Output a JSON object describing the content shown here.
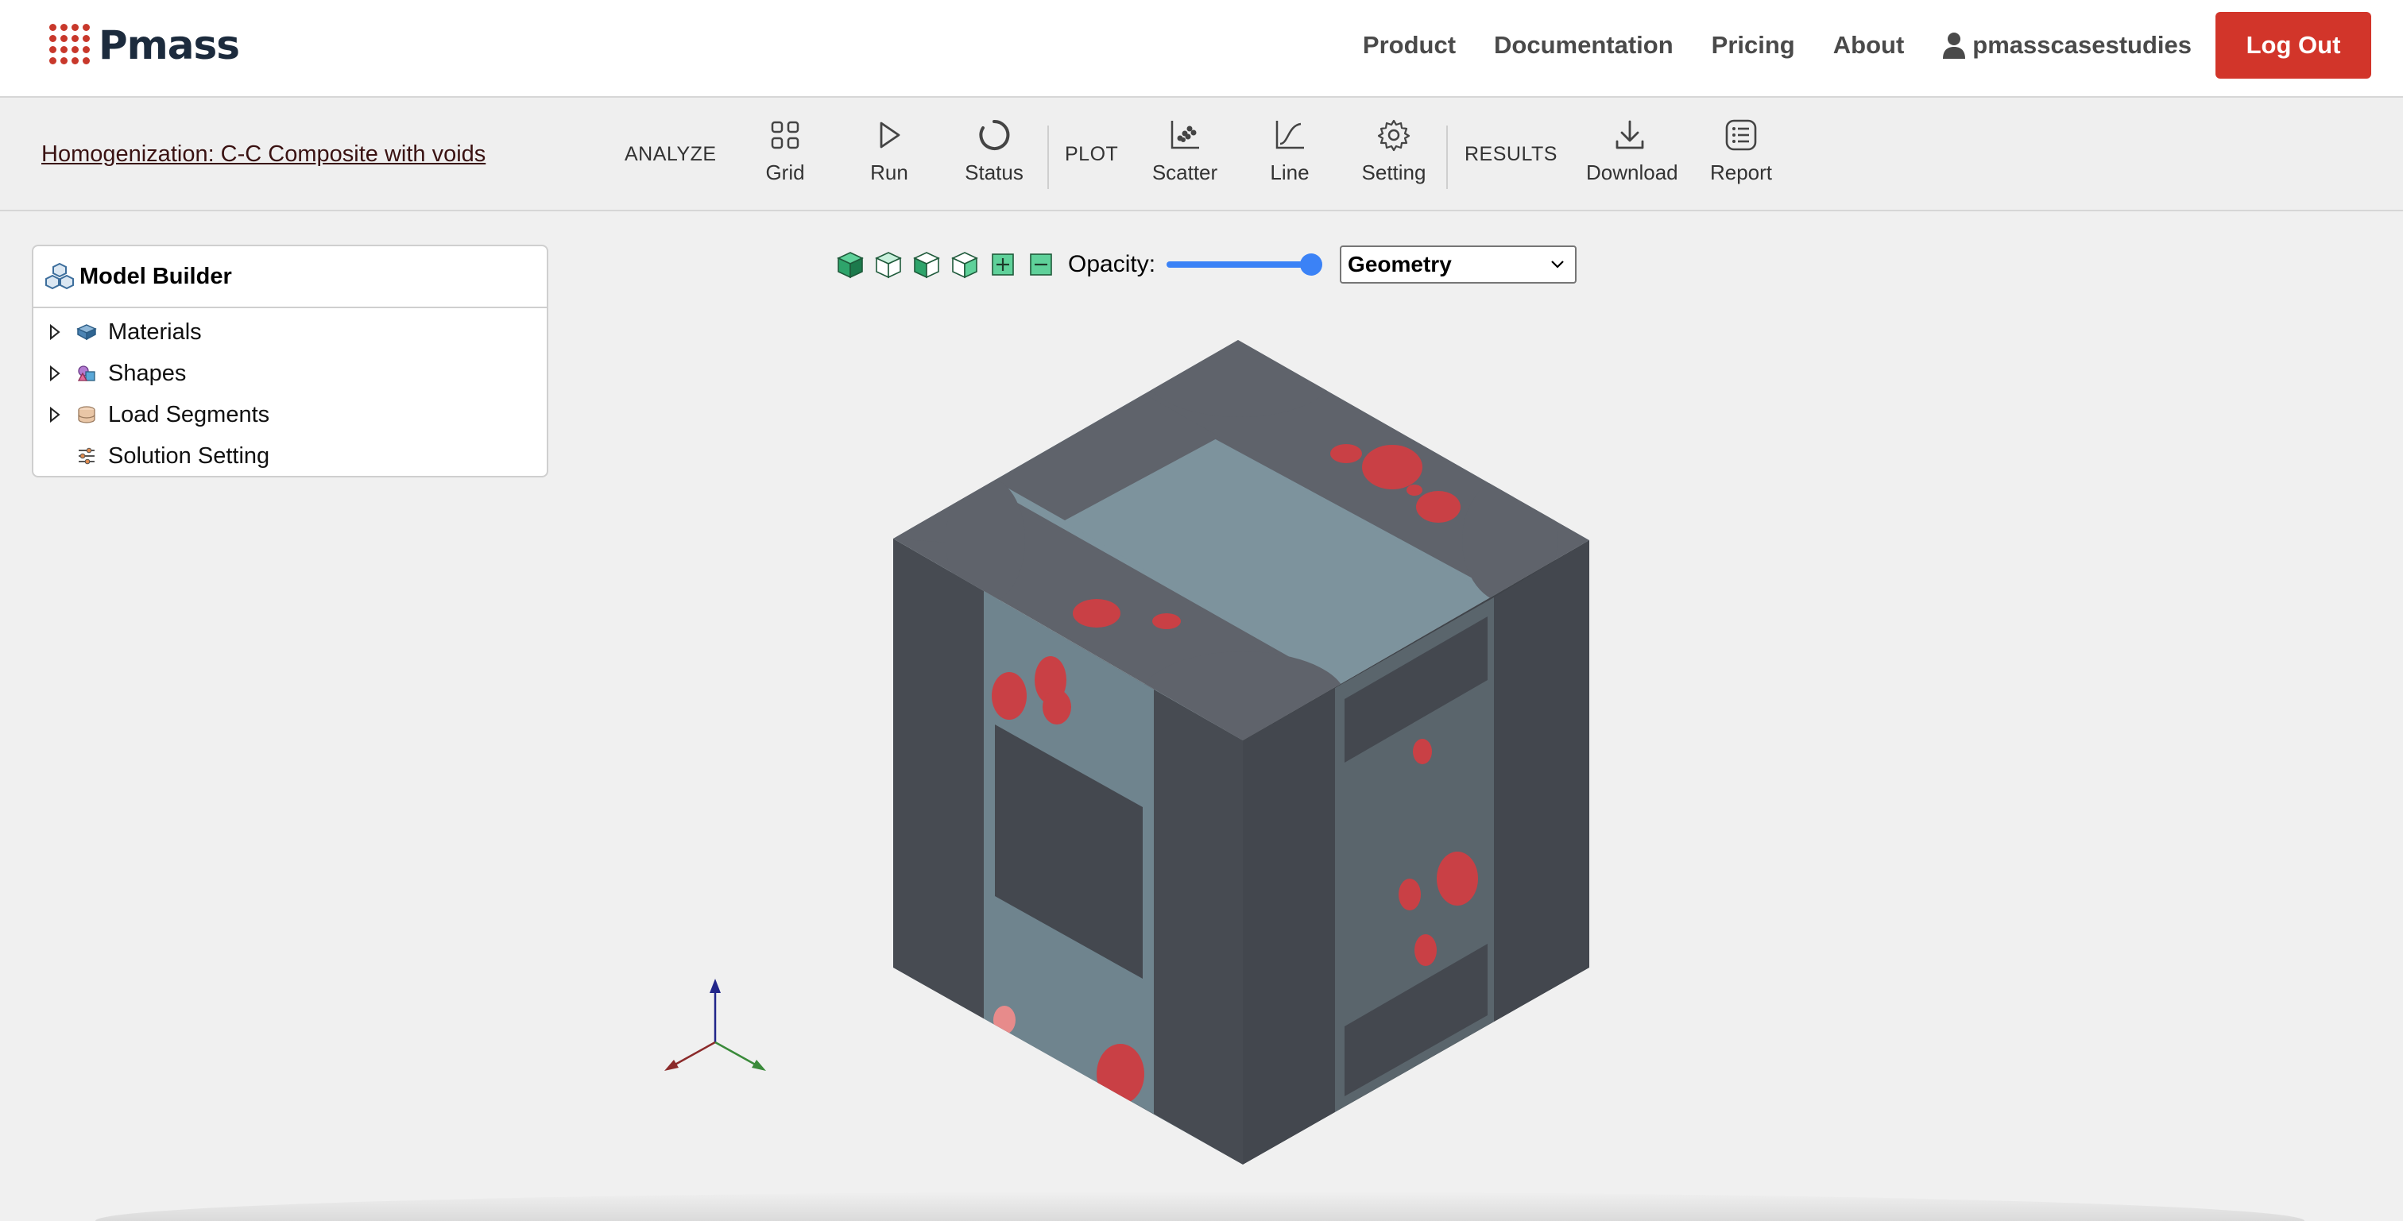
{
  "brand": {
    "name": "Pmass",
    "color": "#c8382b"
  },
  "nav": {
    "links": [
      "Product",
      "Documentation",
      "Pricing",
      "About"
    ],
    "username": "pmasscasestudies",
    "logout_label": "Log Out"
  },
  "toolbar": {
    "project_title": "Homogenization: C-C Composite with voids",
    "sections": {
      "analyze": "ANALYZE",
      "plot": "PLOT",
      "results": "RESULTS"
    },
    "buttons": {
      "grid": {
        "label": "Grid",
        "icon": "grid-icon"
      },
      "run": {
        "label": "Run",
        "icon": "play-icon"
      },
      "status": {
        "label": "Status",
        "icon": "status-ring-icon"
      },
      "scatter": {
        "label": "Scatter",
        "icon": "scatter-plot-icon"
      },
      "line": {
        "label": "Line",
        "icon": "line-plot-icon"
      },
      "setting": {
        "label": "Setting",
        "icon": "gear-icon"
      },
      "download": {
        "label": "Download",
        "icon": "download-icon"
      },
      "report": {
        "label": "Report",
        "icon": "report-list-icon"
      }
    }
  },
  "model_builder": {
    "title": "Model Builder",
    "items": [
      {
        "label": "Materials",
        "icon": "materials-icon",
        "expandable": true
      },
      {
        "label": "Shapes",
        "icon": "shapes-icon",
        "expandable": true
      },
      {
        "label": "Load Segments",
        "icon": "load-segments-icon",
        "expandable": true
      },
      {
        "label": "Solution Setting",
        "icon": "solution-setting-icon",
        "expandable": false
      }
    ]
  },
  "viewport": {
    "opacity_label": "Opacity:",
    "opacity_value": 1.0,
    "view_mode": "Geometry",
    "view_buttons": [
      "solid-cube-icon",
      "wireframe-cube-icon",
      "front-cube-icon",
      "side-cube-icon",
      "zoom-in-icon",
      "zoom-out-icon"
    ],
    "colors": {
      "matrix": "#7d939d",
      "fiber": "#5f636b",
      "void": "#cc3b3b",
      "axis_x": "#8b2a2a",
      "axis_y": "#3a8a3a",
      "axis_z": "#22268a"
    }
  }
}
